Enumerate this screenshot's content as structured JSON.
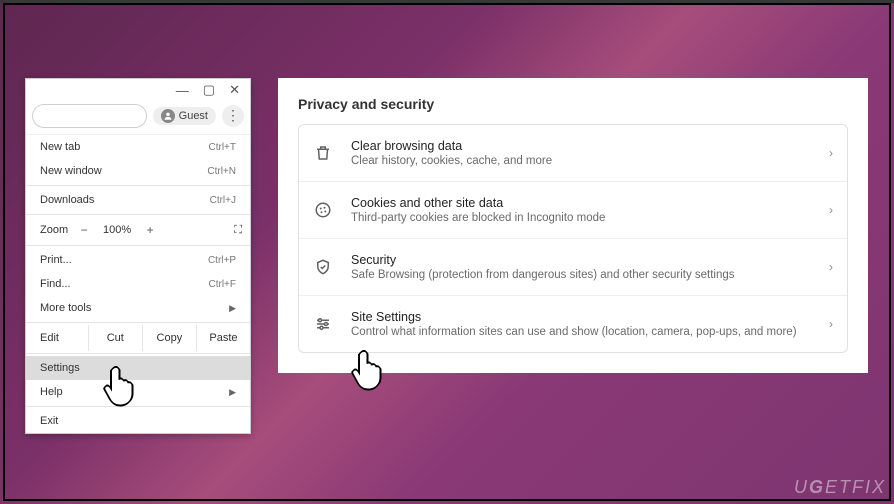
{
  "window_controls": {
    "minimize": "—",
    "maximize": "▢",
    "close": "✕"
  },
  "guest_label": "Guest",
  "menu": {
    "new_tab": "New tab",
    "new_tab_sc": "Ctrl+T",
    "new_window": "New window",
    "new_window_sc": "Ctrl+N",
    "downloads": "Downloads",
    "downloads_sc": "Ctrl+J",
    "zoom": "Zoom",
    "zoom_pct": "100%",
    "print": "Print...",
    "print_sc": "Ctrl+P",
    "find": "Find...",
    "find_sc": "Ctrl+F",
    "more_tools": "More tools",
    "edit": "Edit",
    "cut": "Cut",
    "copy": "Copy",
    "paste": "Paste",
    "settings": "Settings",
    "help": "Help",
    "exit": "Exit"
  },
  "panel": {
    "heading": "Privacy and security",
    "rows": [
      {
        "title": "Clear browsing data",
        "desc": "Clear history, cookies, cache, and more"
      },
      {
        "title": "Cookies and other site data",
        "desc": "Third-party cookies are blocked in Incognito mode"
      },
      {
        "title": "Security",
        "desc": "Safe Browsing (protection from dangerous sites) and other security settings"
      },
      {
        "title": "Site Settings",
        "desc": "Control what information sites can use and show (location, camera, pop-ups, and more)"
      }
    ]
  },
  "watermark": "UGETFIX"
}
